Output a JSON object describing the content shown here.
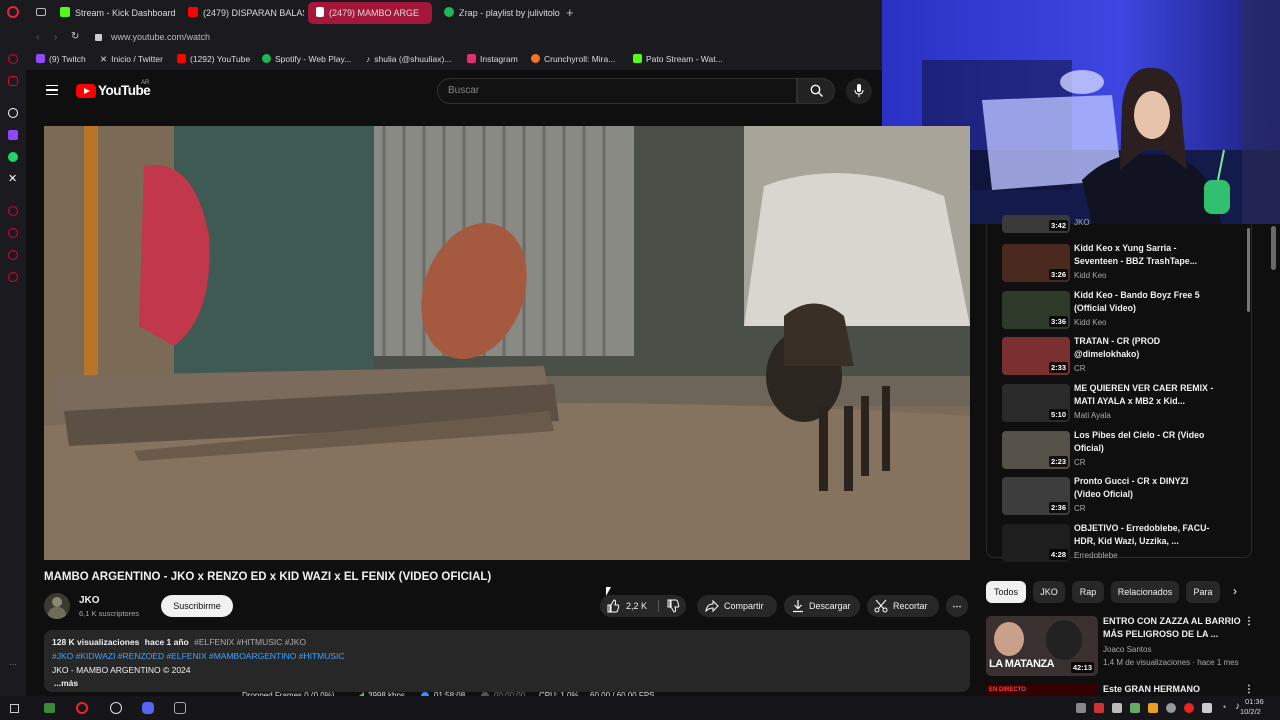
{
  "browser": {
    "tabs": [
      {
        "label": "Stream - Kick Dashboard",
        "color": "#53fc18"
      },
      {
        "label": "(2479) DISPARAN BALAS",
        "color": "#ff0000"
      },
      {
        "label": "(2479) MAMBO ARGE",
        "color": "#ff0000"
      },
      {
        "label": "Ꮓrap - playlist by julivitolo",
        "color": "#1db954"
      }
    ],
    "url": "www.youtube.com/watch",
    "bookmarks": [
      {
        "label": "(9) Twitch",
        "color": "#9146ff"
      },
      {
        "label": "Inicio / Twitter",
        "color": "#ffffff"
      },
      {
        "label": "(1292) YouTube",
        "color": "#ff0000"
      },
      {
        "label": "Spotify - Web Play...",
        "color": "#1db954"
      },
      {
        "label": "shulia (@shuuliax)...",
        "color": "#ffffff"
      },
      {
        "label": "Instagram",
        "color": "#e1306c"
      },
      {
        "label": "Crunchyroll: Mira...",
        "color": "#f47521"
      },
      {
        "label": "Pato Stream - Wat...",
        "color": "#53fc18"
      }
    ]
  },
  "youtube": {
    "logo": "YouTube",
    "region": "AR",
    "search_placeholder": "Buscar"
  },
  "video": {
    "title": "MAMBO ARGENTINO - JKO x RENZO ED x KID WAZI x EL FENIX (VIDEO OFICIAL)",
    "channel": "JKO",
    "subscribers": "6,1 K suscriptores",
    "subscribe_label": "Suscribirme",
    "likes": "2,2 K",
    "share_label": "Compartir",
    "download_label": "Descargar",
    "clip_label": "Recortar",
    "views": "128 K visualizaciones",
    "age": "hace 1 año",
    "top_tags": "#ELFENIX #HITMUSIC #JKO",
    "tags": "#JKO #KIDWAZI #RENZOED #ELFENIX #MAMBOARGENTINO #HITMUSIC",
    "description": "JKO - MAMBO ARGENTINO © 2024",
    "more": "...más"
  },
  "recommendations": [
    {
      "title": "",
      "channel": "JKO",
      "duration": "3:42",
      "tone": "#3a3a3a"
    },
    {
      "title": "Kidd Keo x Yung Sarria - Seventeen - BBZ TrashTape...",
      "channel": "Kidd Keo",
      "duration": "3:26",
      "tone": "#4a2a1e"
    },
    {
      "title": "Kidd Keo - Bando Boyz Free 5 (Official Video)",
      "channel": "Kidd Keo",
      "duration": "3:36",
      "tone": "#2e3a2a"
    },
    {
      "title": "TRATAN - CR (PROD @dimelokhako)",
      "channel": "CR",
      "duration": "2:33",
      "tone": "#7a3030"
    },
    {
      "title": "ME QUIEREN VER CAER REMIX - MATI AYALA x MB2 x Kid...",
      "channel": "Mati Ayala",
      "duration": "5:10",
      "tone": "#2a2a2a"
    },
    {
      "title": "Los Pibes del Cielo - CR (Video Oficial)",
      "channel": "CR",
      "duration": "2:23",
      "tone": "#555048"
    },
    {
      "title": "Pronto Gucci - CR x DINYZI (Video Oficial)",
      "channel": "CR",
      "duration": "2:36",
      "tone": "#3c3c3c"
    },
    {
      "title": "OBJETIVO - Erredoblebe, FACU-HDR, Kid Wazi, Uzzika, ...",
      "channel": "Erredoblebe",
      "duration": "4:28",
      "tone": "#1e1e1e"
    }
  ],
  "chips": [
    "Todos",
    "JKO",
    "Rap",
    "Relacionados",
    "Para"
  ],
  "suggested": [
    {
      "title": "ENTRO CON ZAZZA AL BARRIO MÁS PELIGROSO DE LA ...",
      "channel": "Joaco Santos",
      "meta": "1,4 M de visualizaciones · hace 1 mes",
      "duration": "42:13",
      "overlay": "LA MATANZA"
    },
    {
      "title": "Este GRAN HERMANO",
      "overlay": "EN DIRECTO"
    }
  ],
  "obs": {
    "dropped": "Dropped Frames 0 (0.0%)",
    "bitrate": "3998 kbps",
    "rec_time": "01:58:08",
    "idle_time": "00:00:00",
    "cpu": "CPU: 1.0%",
    "fps": "60.00 / 60.00 FPS"
  },
  "clock": {
    "time": "01:36",
    "date": "10/2/2"
  }
}
